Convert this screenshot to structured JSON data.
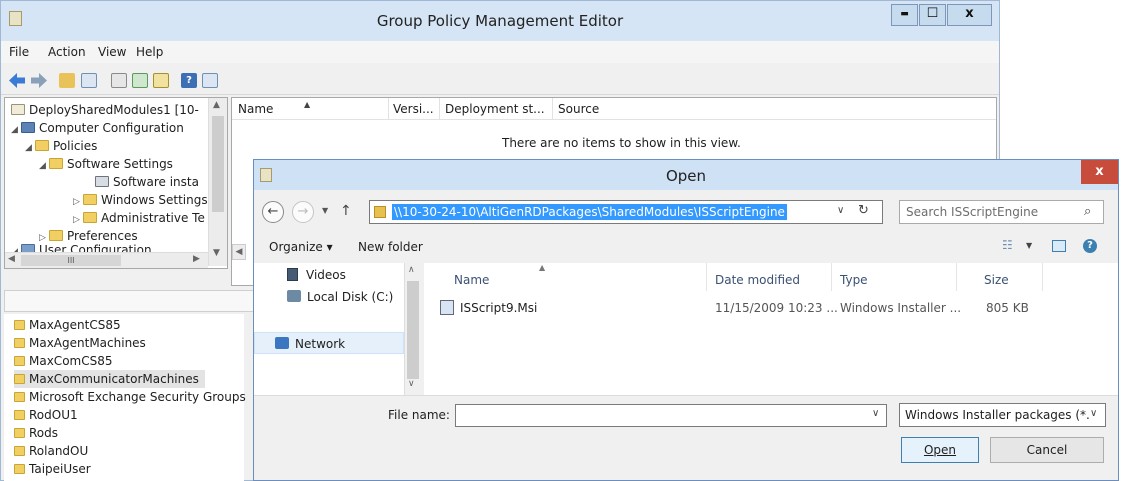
{
  "gpme": {
    "title": "Group Policy Management Editor",
    "window_buttons": {
      "minimize": "▬",
      "maximize": "☐",
      "close": "x"
    },
    "menu": [
      "File",
      "Action",
      "View",
      "Help"
    ],
    "tree": {
      "items": [
        {
          "label": "DeploySharedModules1 [10-",
          "indent": 0,
          "arrow": ""
        },
        {
          "label": "Computer Configuration",
          "indent": 1,
          "arrow": "◢"
        },
        {
          "label": "Policies",
          "indent": 2,
          "arrow": "◢"
        },
        {
          "label": "Software Settings",
          "indent": 3,
          "arrow": "◢"
        },
        {
          "label": "Software insta",
          "indent": 4,
          "arrow": ""
        },
        {
          "label": "Windows Settings",
          "indent": 3,
          "arrow": "▷"
        },
        {
          "label": "Administrative Te",
          "indent": 3,
          "arrow": "▷"
        },
        {
          "label": "Preferences",
          "indent": 2,
          "arrow": "▷"
        },
        {
          "label": "User Configuration",
          "indent": 1,
          "arrow": "◢"
        }
      ],
      "hscroll_thumb": "III"
    },
    "list": {
      "columns": [
        "Name",
        "Versi...",
        "Deployment st...",
        "Source"
      ],
      "empty_message": "There are no items to show in this view."
    }
  },
  "ou_list": [
    "MaxAgentCS85",
    "MaxAgentMachines",
    "MaxComCS85",
    "MaxCommunicatorMachines",
    "Microsoft Exchange Security Groups",
    "RodOU1",
    "Rods",
    "RolandOU",
    "TaipeiUser"
  ],
  "dialog": {
    "title": "Open",
    "close": "x",
    "address_path": "\\\\10-30-24-10\\AltiGenRDPackages\\SharedModules\\ISScriptEngine",
    "search_placeholder": "Search ISScriptEngine",
    "organize": "Organize ▾",
    "new_folder": "New folder",
    "nav_items": [
      "Videos",
      "Local Disk (C:)",
      "Network"
    ],
    "columns": [
      "Name",
      "Date modified",
      "Type",
      "Size"
    ],
    "files": [
      {
        "name": "ISScript9.Msi",
        "date": "11/15/2009 10:23 ...",
        "type": "Windows Installer ...",
        "size": "805 KB"
      }
    ],
    "file_name_label": "File name:",
    "file_name_value": "",
    "file_type": "Windows Installer packages (*.r",
    "open_label": "Open",
    "cancel_label": "Cancel"
  },
  "colors": {
    "accent": "#3399ff",
    "title_bg": "#d5e5f5",
    "close_red": "#c74c3c"
  }
}
